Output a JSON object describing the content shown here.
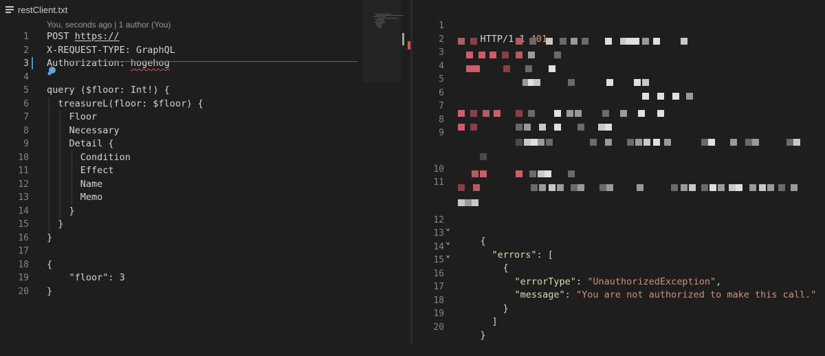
{
  "left_tab": {
    "filename": "restClient.txt",
    "icon": "lines-icon"
  },
  "codelens": "You, seconds ago | 1 author (You)",
  "left_editor": {
    "active_line": 3,
    "lines": [
      {
        "n": "1",
        "text": "POST https://"
      },
      {
        "n": "2",
        "text": "X-REQUEST-TYPE: GraphQL"
      },
      {
        "n": "3",
        "text": "Authorization: hogehog"
      },
      {
        "n": "4",
        "text": ""
      },
      {
        "n": "5",
        "text": "query ($floor: Int!) {"
      },
      {
        "n": "6",
        "text": "  treasureL(floor: $floor) {"
      },
      {
        "n": "7",
        "text": "    Floor"
      },
      {
        "n": "8",
        "text": "    Necessary"
      },
      {
        "n": "9",
        "text": "    Detail {"
      },
      {
        "n": "10",
        "text": "      Condition"
      },
      {
        "n": "11",
        "text": "      Effect"
      },
      {
        "n": "12",
        "text": "      Name"
      },
      {
        "n": "13",
        "text": "      Memo"
      },
      {
        "n": "14",
        "text": "    }"
      },
      {
        "n": "15",
        "text": "  }"
      },
      {
        "n": "16",
        "text": "}"
      },
      {
        "n": "17",
        "text": ""
      },
      {
        "n": "18",
        "text": "{"
      },
      {
        "n": "19",
        "text": "    \"floor\": 3"
      },
      {
        "n": "20",
        "text": "}"
      }
    ]
  },
  "right_editor": {
    "status_line": {
      "protocol": "HTTP/1.1",
      "code": "401"
    },
    "line_numbers": [
      "1",
      "2",
      "3",
      "4",
      "5",
      "6",
      "7",
      "8",
      "9",
      "10",
      "11",
      "12",
      "13",
      "14",
      "15",
      "16",
      "17",
      "18",
      "19",
      "20"
    ],
    "json": {
      "open_brace": "{",
      "errors_key": "\"errors\"",
      "colon_bracket": ": [",
      "obj_open": "{",
      "errorType_key": "\"errorType\"",
      "errorType_value": "\"UnauthorizedException\"",
      "message_key": "\"message\"",
      "message_value": "\"You are not authorized to make this call.\"",
      "obj_close": "}",
      "array_close": "]",
      "close_brace": "}",
      "colon": ": ",
      "comma": ","
    }
  },
  "colors": {
    "background": "#1e1e1e",
    "line_number": "#858585",
    "status_code": "#d59c70",
    "json_key": "#dcdcaa",
    "json_string": "#ce9178",
    "active_line_bar": "#2aa0d6"
  }
}
